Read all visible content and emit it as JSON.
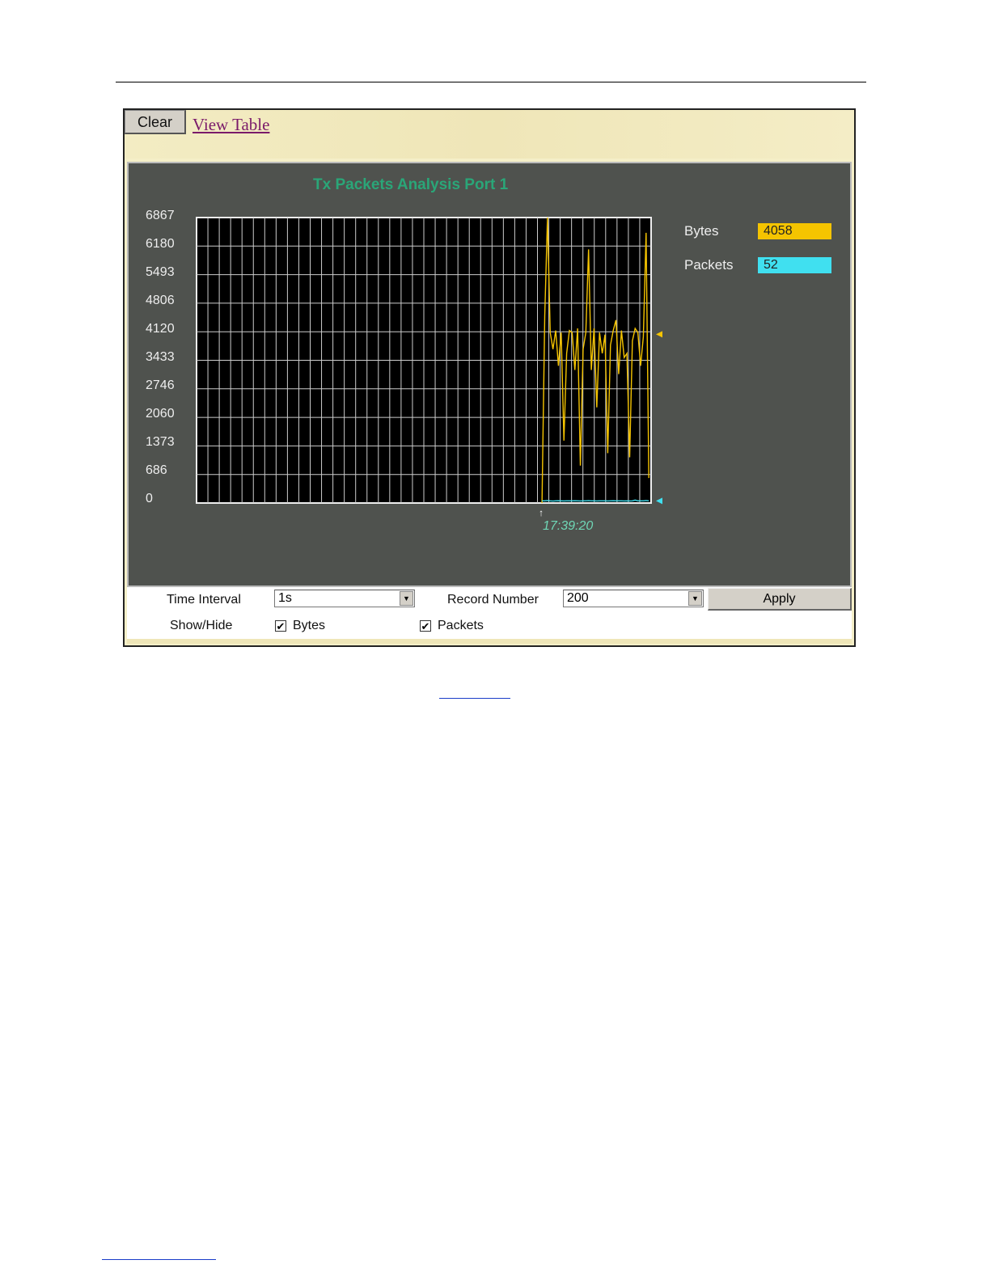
{
  "toolbar": {
    "clear_label": "Clear",
    "view_table_label": "View Table"
  },
  "chart_data": {
    "type": "line",
    "title": "Tx Packets Analysis  Port 1",
    "y_ticks": [
      "6867",
      "6180",
      "5493",
      "4806",
      "4120",
      "3433",
      "2746",
      "2060",
      "1373",
      "686",
      "0"
    ],
    "ylim": [
      0,
      6867
    ],
    "xlim": [
      0,
      200
    ],
    "start_time_label": "17:39:20",
    "grid": true,
    "series": [
      {
        "name": "Bytes",
        "color": "#f5c400",
        "start_index": 152,
        "values": [
          0,
          4500,
          6867,
          4100,
          3700,
          4150,
          3300,
          4100,
          1500,
          3600,
          4150,
          4100,
          3200,
          4200,
          900,
          3700,
          4100,
          6100,
          3200,
          4200,
          2300,
          4100,
          3600,
          4050,
          1200,
          3800,
          4150,
          4400,
          3100,
          4150,
          3500,
          3600,
          1100,
          3900,
          4200,
          4100,
          3300,
          4000,
          6500,
          600
        ]
      },
      {
        "name": "Packets",
        "color": "#40e0f0",
        "start_index": 152,
        "values": [
          52,
          52,
          60,
          52,
          48,
          52,
          55,
          52,
          50,
          52,
          52,
          52,
          55,
          52,
          50,
          52,
          52,
          58,
          52,
          52,
          50,
          52,
          52,
          52,
          50,
          52,
          55,
          52,
          52,
          52,
          50,
          52,
          50,
          52,
          70,
          52,
          52,
          52,
          60,
          52
        ]
      }
    ]
  },
  "legend": {
    "bytes_label": "Bytes",
    "bytes_value": "4058",
    "packets_label": "Packets",
    "packets_value": "52"
  },
  "controls": {
    "time_interval_label": "Time Interval",
    "time_interval_value": "1s",
    "record_number_label": "Record Number",
    "record_number_value": "200",
    "apply_label": "Apply",
    "show_hide_label": "Show/Hide",
    "bytes_checkbox_label": "Bytes",
    "bytes_checked": true,
    "packets_checkbox_label": "Packets",
    "packets_checked": true
  }
}
